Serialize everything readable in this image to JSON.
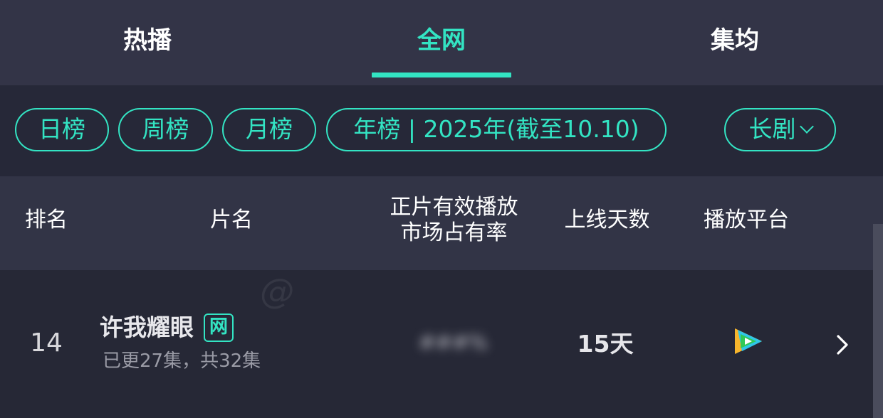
{
  "tabs": [
    {
      "label": "热播",
      "active": false
    },
    {
      "label": "全网",
      "active": true
    },
    {
      "label": "集均",
      "active": false
    }
  ],
  "filters": {
    "daily": "日榜",
    "weekly": "周榜",
    "monthly": "月榜",
    "yearly": "年榜 | 2025年(截至10.10)",
    "category": "长剧"
  },
  "table": {
    "headers": {
      "rank": "排名",
      "title": "片名",
      "share_line1": "正片有效播放",
      "share_line2": "市场占有率",
      "days": "上线天数",
      "platform": "播放平台"
    },
    "rows": [
      {
        "rank": "14",
        "title": "许我耀眼",
        "badge": "网",
        "episodes": "已更27集，共32集",
        "share": "",
        "days": "15天",
        "platform_icon": "tencent-video-icon"
      }
    ]
  },
  "colors": {
    "accent": "#33e4c3",
    "background": "#272939",
    "header_bg": "#333447"
  }
}
